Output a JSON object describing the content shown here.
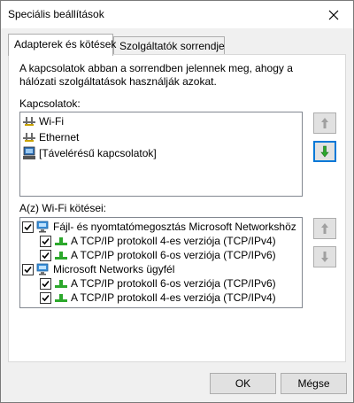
{
  "window": {
    "title": "Speciális beállítások"
  },
  "tabs": [
    {
      "label": "Adapterek és kötések",
      "active": true
    },
    {
      "label": "Szolgáltatók sorrendje",
      "active": false
    }
  ],
  "adapters": {
    "description": "A kapcsolatok abban a sorrendben jelennek meg, ahogy a hálózati szolgáltatások használják azokat.",
    "connections_label": "Kapcsolatok:",
    "connections": [
      {
        "label": "Wi-Fi",
        "icon": "network-adapter-icon"
      },
      {
        "label": "Ethernet",
        "icon": "network-adapter-icon"
      },
      {
        "label": "[Távelérésű kapcsolatok]",
        "icon": "remote-access-icon"
      }
    ],
    "bindings_label": "A(z) Wi-Fi kötései:",
    "bindings": [
      {
        "label": "Fájl- és nyomtatómegosztás Microsoft Networkshöz",
        "checked": true,
        "level": 0,
        "icon": "network-service-icon"
      },
      {
        "label": "A TCP/IP protokoll 4-es verziója (TCP/IPv4)",
        "checked": true,
        "level": 1,
        "icon": "protocol-icon"
      },
      {
        "label": "A TCP/IP protokoll 6-os verziója (TCP/IPv6)",
        "checked": true,
        "level": 1,
        "icon": "protocol-icon"
      },
      {
        "label": "Microsoft Networks ügyfél",
        "checked": true,
        "level": 0,
        "icon": "network-service-icon"
      },
      {
        "label": "A TCP/IP protokoll 6-os verziója (TCP/IPv6)",
        "checked": true,
        "level": 1,
        "icon": "protocol-icon"
      },
      {
        "label": "A TCP/IP protokoll 4-es verziója (TCP/IPv4)",
        "checked": true,
        "level": 1,
        "icon": "protocol-icon"
      }
    ]
  },
  "buttons": {
    "ok": "OK",
    "cancel": "Mégse"
  },
  "colors": {
    "accent": "#0078d7",
    "move_down_enabled": "#2ca82c",
    "disabled_arrow": "#a0a0a0"
  }
}
